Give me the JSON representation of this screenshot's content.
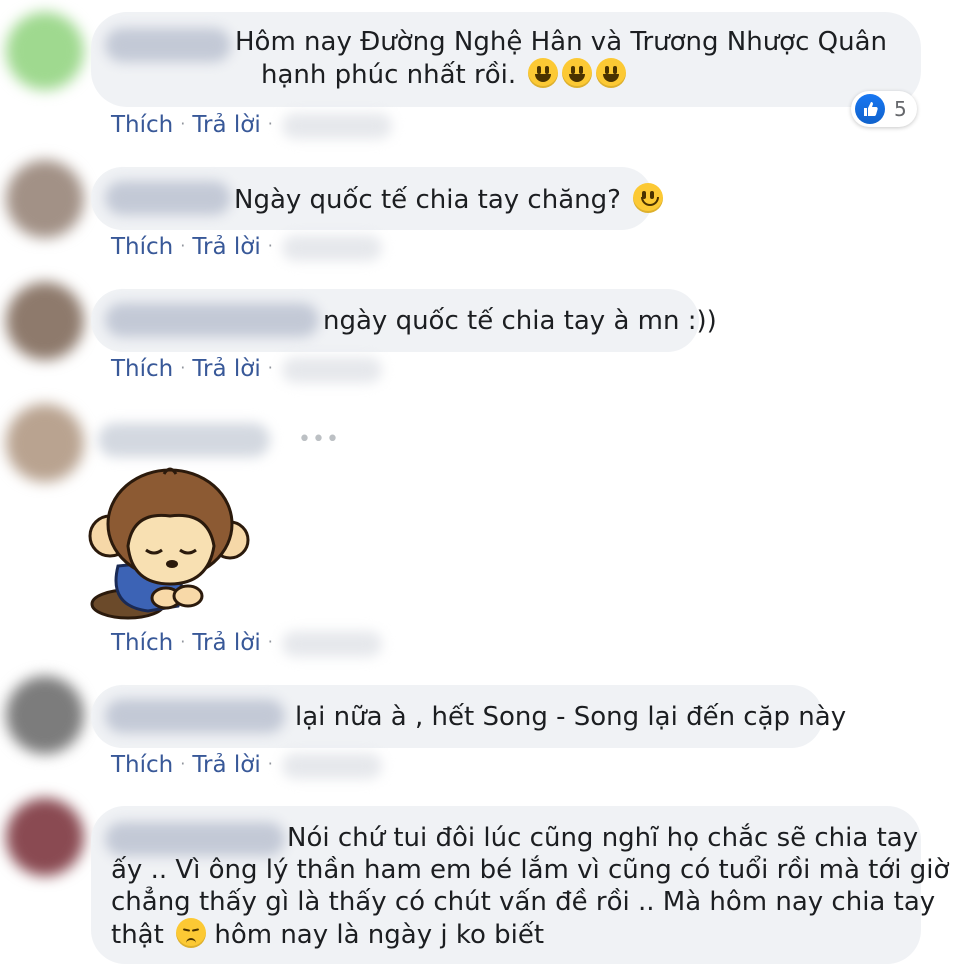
{
  "comments": [
    {
      "text": "Hôm nay Đường Nghệ Hân và Trương Nhược Quân",
      "text2": "hạnh phúc nhất rồi.",
      "emojis": [
        "grinning-face",
        "grinning-face",
        "grinning-face"
      ],
      "reaction_count": "5"
    },
    {
      "text": "Ngày quốc tế chia tay chăng?",
      "emoji": "slightly-smiling-face"
    },
    {
      "text": "ngày quốc tế chia tay à mn :))"
    },
    {
      "sticker": "monkey-sad-sticker"
    },
    {
      "text": "lại nữa à , hết Song - Song lại đến cặp này"
    },
    {
      "line1": "Nói chứ tui đôi lúc cũng nghĩ họ chắc sẽ chia tay",
      "line2": "ấy .. Vì ông lý thần ham em bé lắm vì cũng có tuổi rồi mà tới giờ",
      "line3": "chẳng thấy gì là thấy có chút vấn đề rồi .. Mà hôm nay chia tay",
      "line4a": "thật",
      "line4b": "hôm nay là ngày j ko biết",
      "emoji": "pensive-face"
    }
  ],
  "actions": {
    "like": "Thích",
    "reply": "Trả lời",
    "separator": "·"
  },
  "colors": {
    "link": "#385898",
    "bubble": "#f0f2f5",
    "like_blue": "#1877f2"
  }
}
